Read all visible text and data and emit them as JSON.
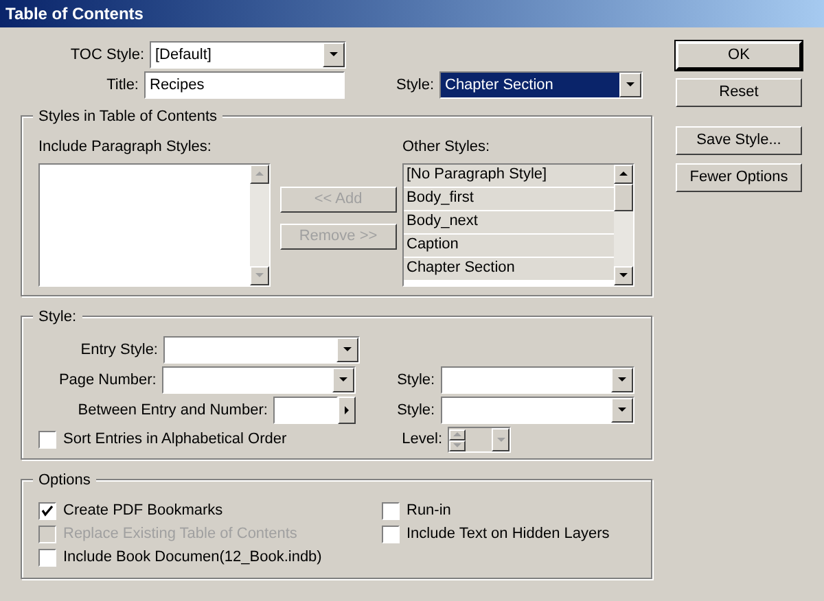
{
  "window": {
    "title": "Table of Contents"
  },
  "toc_style": {
    "label": "TOC Style:",
    "value": "[Default]"
  },
  "title": {
    "label": "Title:",
    "value": "Recipes"
  },
  "title_style": {
    "label": "Style:",
    "value": "Chapter Section",
    "focused": true
  },
  "styles_group": {
    "legend": "Styles in Table of Contents",
    "include_label": "Include Paragraph Styles:",
    "other_label": "Other Styles:",
    "add_button": {
      "label": "<< Add",
      "disabled": true
    },
    "remove_button": {
      "label": "Remove >>",
      "disabled": true
    },
    "other_styles": [
      "[No Paragraph Style]",
      "Body_first",
      "Body_next",
      "Caption",
      "Chapter Section"
    ]
  },
  "style_group": {
    "legend": "Style:",
    "entry_style": {
      "label": "Entry Style:"
    },
    "page_number": {
      "label": "Page Number:"
    },
    "page_number_style": {
      "label": "Style:"
    },
    "between": {
      "label": "Between Entry and Number:"
    },
    "between_style": {
      "label": "Style:"
    },
    "sort": {
      "label": "Sort Entries in Alphabetical Order",
      "checked": false,
      "disabled": false
    },
    "level": {
      "label": "Level:",
      "disabled": true
    }
  },
  "options": {
    "legend": "Options",
    "left": [
      {
        "label": "Create PDF Bookmarks",
        "checked": true,
        "disabled": false
      },
      {
        "label": "Replace Existing Table of Contents",
        "checked": false,
        "disabled": true
      },
      {
        "label": "Include Book Documen(12_Book.indb)",
        "checked": false,
        "disabled": false
      }
    ],
    "right": [
      {
        "label": "Run-in",
        "checked": false,
        "disabled": false
      },
      {
        "label": "Include Text on Hidden Layers",
        "checked": false,
        "disabled": false
      }
    ]
  },
  "buttons": [
    {
      "label": "OK",
      "default": true
    },
    {
      "label": "Reset",
      "default": false
    },
    {
      "label": "Save Style...",
      "default": false
    },
    {
      "label": "Fewer Options",
      "default": false
    }
  ]
}
